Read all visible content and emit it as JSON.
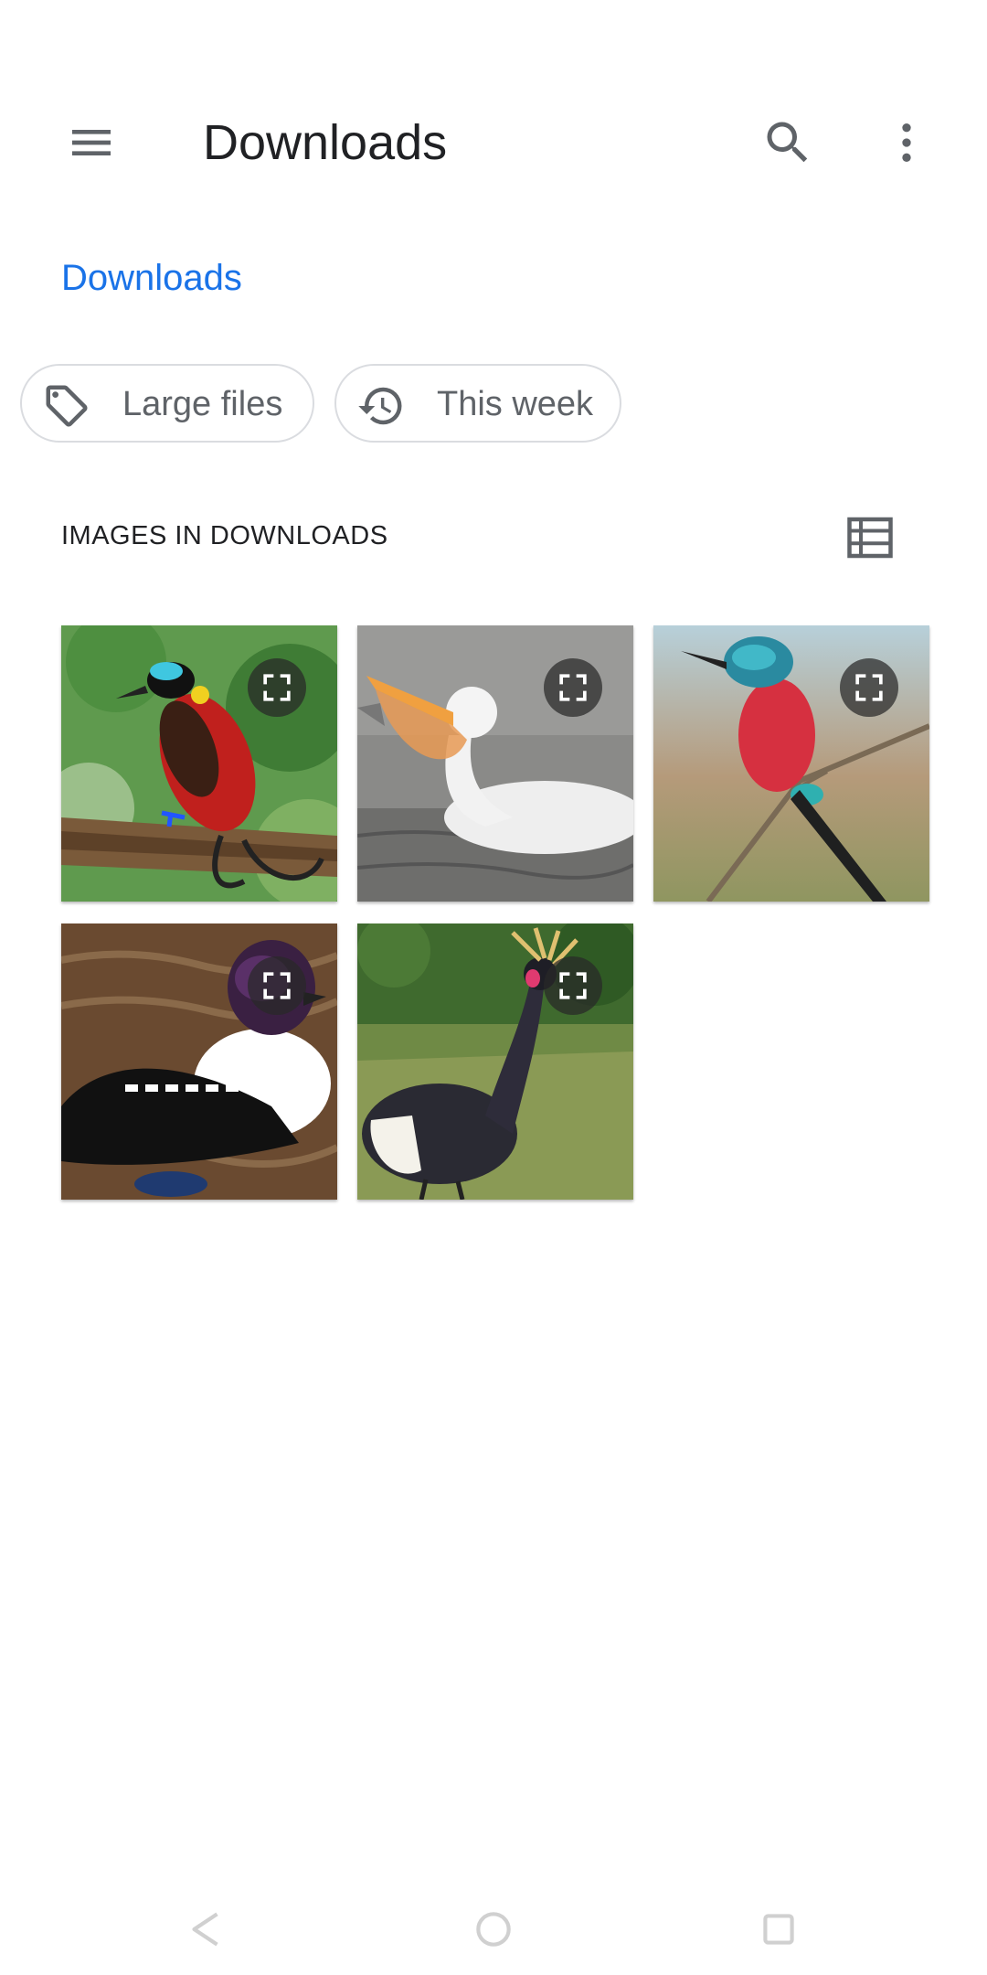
{
  "toolbar": {
    "title": "Downloads",
    "menu_icon": "hamburger-menu-icon",
    "search_icon": "search-icon",
    "more_icon": "more-vertical-icon"
  },
  "breadcrumb": {
    "label": "Downloads"
  },
  "chips": [
    {
      "label": "Large files",
      "icon": "tag-icon"
    },
    {
      "label": "This week",
      "icon": "history-icon"
    }
  ],
  "section": {
    "header": "IMAGES IN DOWNLOADS",
    "view_toggle_icon": "list-view-icon"
  },
  "images": [
    {
      "subject": "bird-of-paradise",
      "badge_icon": "expand-icon"
    },
    {
      "subject": "pelican",
      "badge_icon": "expand-icon"
    },
    {
      "subject": "carmine-bee-eater",
      "badge_icon": "expand-icon"
    },
    {
      "subject": "goldeneye-duck",
      "badge_icon": "expand-icon"
    },
    {
      "subject": "crowned-crane",
      "badge_icon": "expand-icon"
    }
  ],
  "colors": {
    "accent": "#1a73e8",
    "text_primary": "#202124",
    "text_secondary": "#5f6368",
    "chip_border": "#dadce0",
    "icon_gray": "#5f6368"
  },
  "navbar": {
    "back_icon": "back-icon",
    "home_icon": "home-icon",
    "recents_icon": "recents-icon"
  }
}
